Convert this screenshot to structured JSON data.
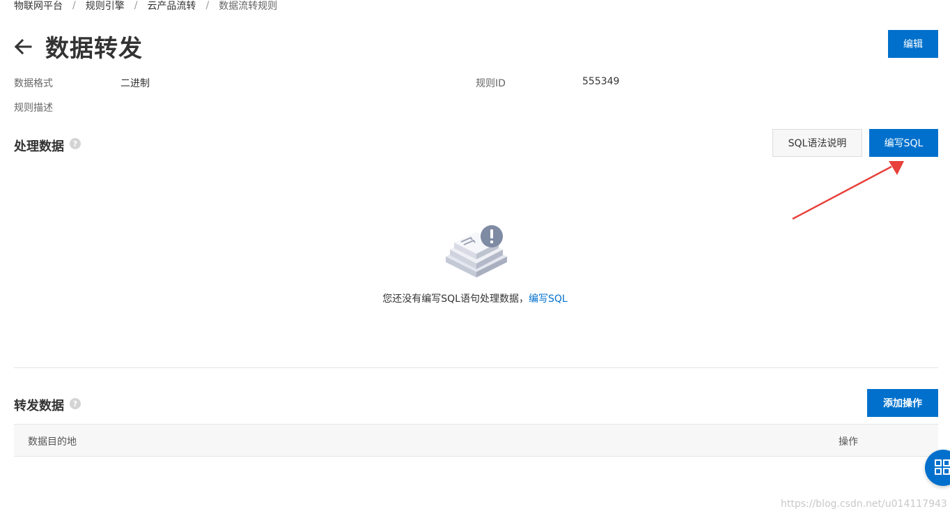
{
  "breadcrumb": {
    "items": [
      "物联网平台",
      "规则引擎",
      "云产品流转",
      "数据流转规则"
    ],
    "separator": "/"
  },
  "header": {
    "title": "数据转发",
    "edit_label": "编辑"
  },
  "info": {
    "data_format_label": "数据格式",
    "data_format_value": "二进制",
    "rule_id_label": "规则ID",
    "rule_id_value": "555349",
    "rule_desc_label": "规则描述"
  },
  "process_section": {
    "title": "处理数据",
    "help_glyph": "?",
    "sql_help_label": "SQL语法说明",
    "write_sql_label": "编写SQL",
    "empty_text": "您还没有编写SQL语句处理数据，",
    "empty_link": "编写SQL"
  },
  "forward_section": {
    "title": "转发数据",
    "help_glyph": "?",
    "add_action_label": "添加操作",
    "columns": [
      "数据目的地",
      "操作"
    ]
  },
  "watermark": "https://blog.csdn.net/u014117943",
  "colors": {
    "primary": "#0070cc",
    "annotation_arrow": "#e8403a"
  },
  "icons": [
    "back-arrow-icon",
    "help-icon",
    "empty-state-icon",
    "grid-icon"
  ]
}
